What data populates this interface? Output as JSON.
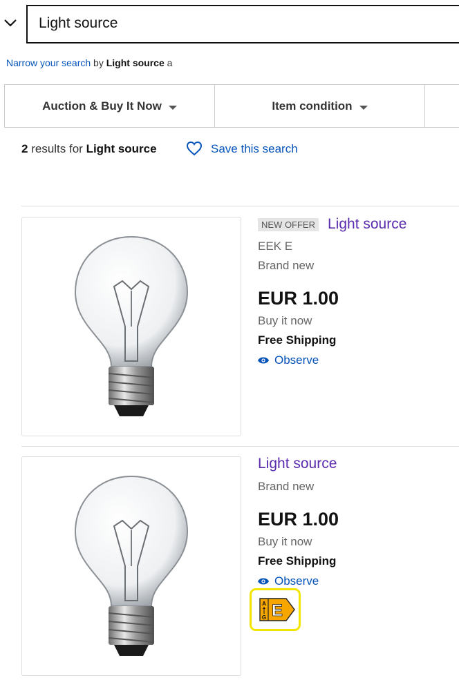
{
  "search": {
    "value": "Light source"
  },
  "narrow": {
    "link": "Narrow your search",
    "by": "by",
    "term": "Light source",
    "suffix": "a"
  },
  "filters": [
    {
      "label": "Auction & Buy It Now"
    },
    {
      "label": "Item condition"
    }
  ],
  "results": {
    "count": "2",
    "text": "results for",
    "term": "Light source",
    "save_label": "Save this search"
  },
  "items": [
    {
      "badge": "NEW OFFER",
      "title": "Light source",
      "subtitle": "EEK E",
      "condition": "Brand new",
      "price": "EUR 1.00",
      "format": "Buy it now",
      "shipping": "Free Shipping",
      "observe": "Observe"
    },
    {
      "title": "Light source",
      "condition": "Brand new",
      "price": "EUR 1.00",
      "format": "Buy it now",
      "shipping": "Free Shipping",
      "observe": "Observe",
      "energy_label": {
        "class": "E",
        "range_top": "A",
        "range_bottom": "G",
        "color": "#f7a600"
      }
    }
  ]
}
